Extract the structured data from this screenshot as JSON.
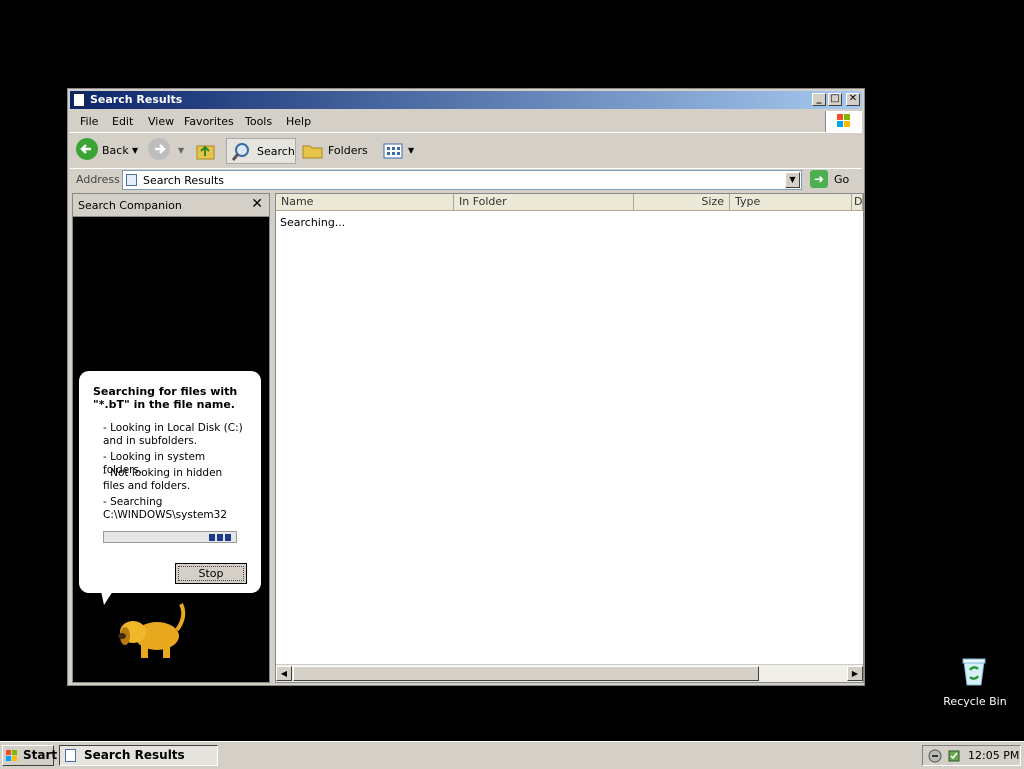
{
  "window": {
    "title": "Search Results",
    "controls": {
      "minimize": "_",
      "maximize": "□",
      "close": "✕"
    }
  },
  "menu": [
    "File",
    "Edit",
    "View",
    "Favorites",
    "Tools",
    "Help"
  ],
  "toolbar": {
    "back_label": "Back",
    "search_label": "Search",
    "folders_label": "Folders"
  },
  "address": {
    "label": "Address",
    "value": "Search Results",
    "go_label": "Go"
  },
  "companion": {
    "title": "Search Companion",
    "close": "✕",
    "heading": "Searching for files with \"*.bT\" in the file name.",
    "lines": [
      "- Looking in Local Disk (C:) and in subfolders.",
      "- Looking in system folders.",
      "- Not looking in hidden files and folders.",
      "- Searching C:\\WINDOWS\\system32"
    ],
    "stop_label": "Stop"
  },
  "results": {
    "columns": [
      "Name",
      "In Folder",
      "Size",
      "Type",
      "D"
    ],
    "status": "Searching..."
  },
  "desktop": {
    "recycle_bin": "Recycle Bin"
  },
  "taskbar": {
    "start_label": "Start",
    "task_label": "Search Results",
    "clock": "12:05 PM"
  },
  "colors": {
    "title_gradient_start": "#0a246a",
    "title_gradient_end": "#a6caf0",
    "progress_block": "#1a3a8a",
    "desktop_bg": "#000000"
  }
}
